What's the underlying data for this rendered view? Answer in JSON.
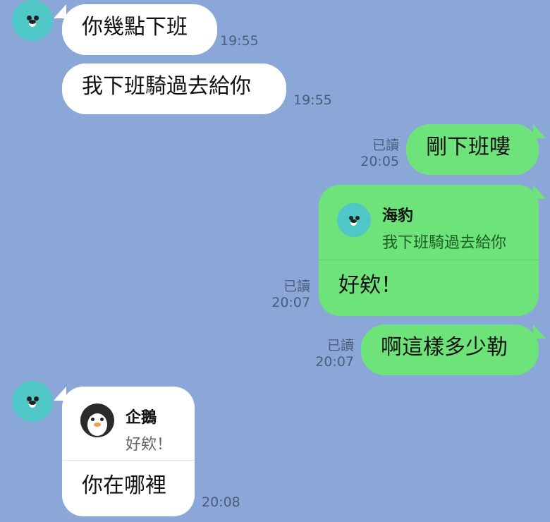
{
  "messages": [
    {
      "id": "m1",
      "text": "你幾點下班",
      "time": "19:55"
    },
    {
      "id": "m2",
      "text": "我下班騎過去給你",
      "time": "19:55"
    },
    {
      "id": "m3",
      "text": "剛下班嘍",
      "read": "已讀",
      "time": "20:05"
    },
    {
      "id": "m4",
      "reply_name": "海豹",
      "reply_quote": "我下班騎過去給你",
      "text": "好欸！",
      "read": "已讀",
      "time": "20:07"
    },
    {
      "id": "m5",
      "text": "啊這樣多少勒",
      "read": "已讀",
      "time": "20:07"
    },
    {
      "id": "m6",
      "reply_name": "企鵝",
      "reply_quote": "好欸！",
      "text": "你在哪裡",
      "time": "20:08"
    }
  ],
  "colors": {
    "background": "#8aa7d8",
    "incoming_bubble": "#ffffff",
    "outgoing_bubble": "#6ee37a",
    "seal_avatar": "#4fc7c6"
  },
  "icons": {
    "contact_avatar": "seal-icon",
    "penguin_avatar": "penguin-icon"
  }
}
